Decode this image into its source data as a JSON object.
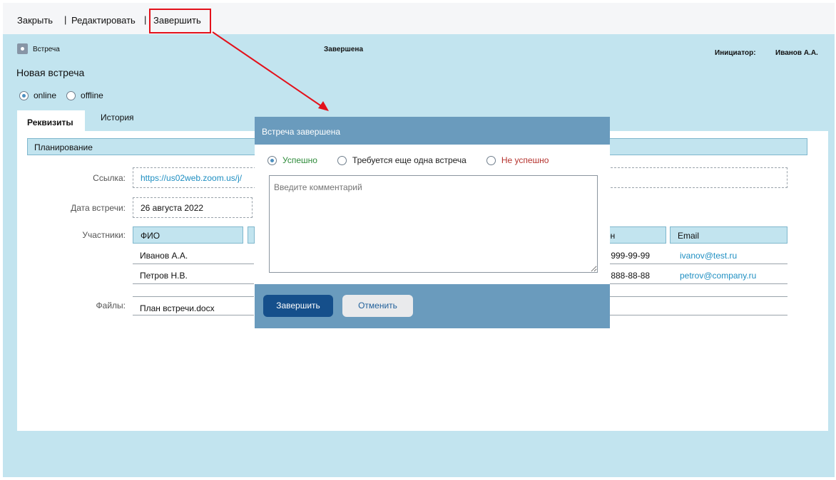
{
  "toolbar": {
    "close_label": "Закрыть",
    "edit_label": "Редактировать",
    "finish_label": "Завершить",
    "separator": "|"
  },
  "header": {
    "doc_type": "Встреча",
    "status": "Завершена",
    "initiator_label": "Инициатор:",
    "initiator_value": "Иванов А.А.",
    "title": "Новая встреча"
  },
  "mode": {
    "options": [
      {
        "label": "online",
        "selected": true
      },
      {
        "label": "offline",
        "selected": false
      }
    ]
  },
  "tabs": [
    {
      "label": "Реквизиты",
      "active": true
    },
    {
      "label": "История",
      "active": false
    }
  ],
  "form": {
    "section_title": "Планирование",
    "link_label": "Ссылка:",
    "link_value": "https://us02web.zoom.us/j/",
    "date_label": "Дата встречи:",
    "date_value": "26 августа 2022",
    "participants_label": "Участники:",
    "participants_columns": [
      "ФИО",
      "он",
      "Email"
    ],
    "participants": [
      {
        "name": "Иванов А.А.",
        "phone": ") 999-99-99",
        "email": "ivanov@test.ru"
      },
      {
        "name": "Петров Н.В.",
        "phone": ") 888-88-88",
        "email": "petrov@company.ru"
      }
    ],
    "files_label": "Файлы:",
    "files": [
      "План встречи.docx"
    ]
  },
  "modal": {
    "title": "Встреча завершена",
    "outcomes": [
      {
        "label": "Успешно",
        "selected": true
      },
      {
        "label": "Требуется еще одна встреча",
        "selected": false
      },
      {
        "label": "Не успешно",
        "selected": false
      }
    ],
    "comment_placeholder": "Введите комментарий",
    "comment_value": "",
    "confirm_label": "Завершить",
    "cancel_label": "Отменить"
  },
  "colors": {
    "background": "#c2e4ef",
    "modal": "#6a9bbd",
    "primary_button": "#154f8b",
    "highlight": "#e3111b",
    "link": "#1f8fc2"
  }
}
